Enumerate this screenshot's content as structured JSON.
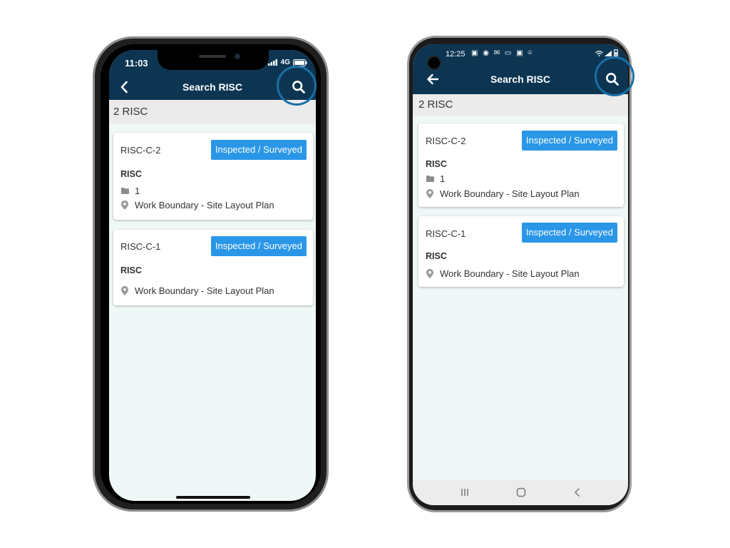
{
  "iphone": {
    "status": {
      "time": "11:03",
      "network": "4G"
    },
    "appbar": {
      "title": "Search RISC"
    },
    "count_label": "2 RISC",
    "cards": [
      {
        "code": "RISC-C-2",
        "status": "Inspected / Surveyed",
        "type": "RISC",
        "folder_count": "1",
        "location": "Work Boundary - Site Layout Plan"
      },
      {
        "code": "RISC-C-1",
        "status": "Inspected / Surveyed",
        "type": "RISC",
        "location": "Work Boundary - Site Layout Plan"
      }
    ]
  },
  "android": {
    "status": {
      "time": "12:25"
    },
    "appbar": {
      "title": "Search RISC"
    },
    "count_label": "2 RISC",
    "cards": [
      {
        "code": "RISC-C-2",
        "status": "Inspected / Surveyed",
        "type": "RISC",
        "folder_count": "1",
        "location": "Work Boundary - Site Layout Plan"
      },
      {
        "code": "RISC-C-1",
        "status": "Inspected / Surveyed",
        "type": "RISC",
        "location": "Work Boundary - Site Layout Plan"
      }
    ],
    "navbar": {
      "recents_icon": "recents-icon",
      "home_icon": "home-icon",
      "back_icon": "back-icon"
    }
  },
  "colors": {
    "appbar": "#0d3552",
    "badge": "#2a96e8",
    "highlight_ring": "#1a6fa7",
    "screen_bg": "#f0f7f7"
  }
}
